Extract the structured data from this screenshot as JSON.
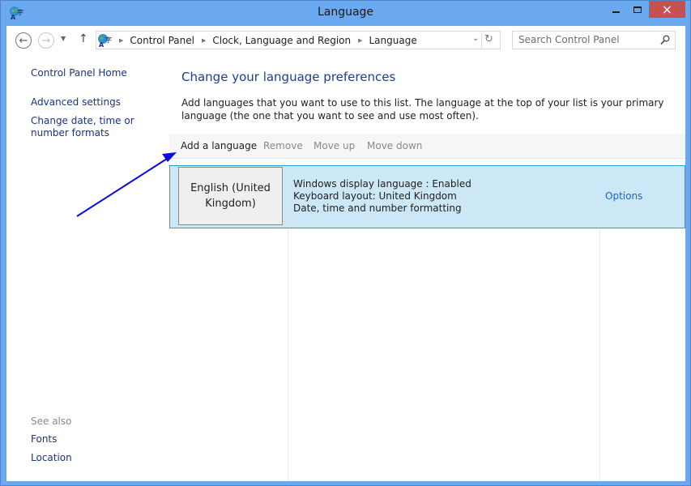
{
  "window": {
    "title": "Language",
    "controls": {
      "minimize": "minimize",
      "maximize": "maximize",
      "close": "×"
    }
  },
  "navigation": {
    "back_glyph": "←",
    "forward_glyph": "→",
    "recent_glyph": "▼",
    "up_glyph": "↑",
    "breadcrumb": [
      "Control Panel",
      "Clock, Language and Region",
      "Language"
    ],
    "breadcrumb_separator": "▶",
    "dropdown_glyph": "⌄",
    "refresh_glyph": "↻",
    "search": {
      "placeholder": "Search Control Panel",
      "value": ""
    }
  },
  "left_pane": {
    "links": [
      "Control Panel Home",
      "Advanced settings",
      "Change date, time or number formats"
    ],
    "see_also": {
      "heading": "See also",
      "links": [
        "Fonts",
        "Location"
      ]
    }
  },
  "main": {
    "title": "Change your language preferences",
    "description": "Add languages that you want to use to this list. The language at the top of your list is your primary language (the one that you want to see and use most often).",
    "toolbar": {
      "add": "Add a language",
      "remove": "Remove",
      "move_up": "Move up",
      "move_down": "Move down"
    },
    "languages": [
      {
        "name": "English (United Kingdom)",
        "details": [
          "Windows display language : Enabled",
          "Keyboard layout: United Kingdom",
          "Date, time and number formatting"
        ],
        "options_label": "Options"
      }
    ]
  },
  "annotation": {
    "type": "arrow",
    "color": "#0a0ae6",
    "points_to": "Add a language"
  },
  "colors": {
    "window_frame": "#6aa9f0",
    "close_button": "#c75050",
    "selected_row": "#cce8f6",
    "selected_border": "#26a0da",
    "link": "#1a3380",
    "heading": "#1e3e8f"
  }
}
